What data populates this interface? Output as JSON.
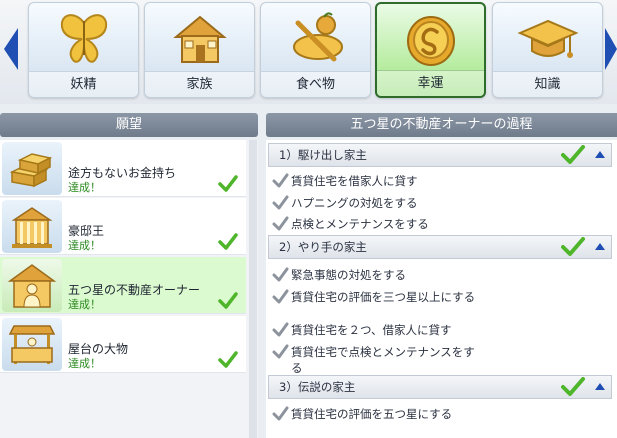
{
  "categories": {
    "tabs": [
      {
        "label": "妖精",
        "icon": "butterfly-icon"
      },
      {
        "label": "家族",
        "icon": "house-icon"
      },
      {
        "label": "食べ物",
        "icon": "food-icon"
      },
      {
        "label": "幸運",
        "icon": "lucky-coin-icon",
        "active": true
      },
      {
        "label": "知識",
        "icon": "graduation-cap-icon"
      }
    ]
  },
  "left_panel": {
    "title": "願望",
    "aspirations": [
      {
        "name": "途方もないお金持ち",
        "status": "達成！",
        "icon": "gold-bars-icon"
      },
      {
        "name": "豪邸王",
        "status": "達成！",
        "icon": "mansion-icon"
      },
      {
        "name": "五つ星の不動産オーナー",
        "status": "達成！",
        "icon": "property-owner-icon",
        "selected": true
      },
      {
        "name": "屋台の大物",
        "status": "達成！",
        "icon": "market-stall-icon"
      }
    ]
  },
  "right_panel": {
    "title": "五つ星の不動産オーナーの過程",
    "milestones": [
      {
        "title": "1）駆け出し家主",
        "objectives": [
          "賃貸住宅を借家人に貸す",
          "ハプニングの対処をする",
          "点検とメンテナンスをする"
        ]
      },
      {
        "title": "2）やり手の家主",
        "objectives": [
          "緊急事態の対処をする",
          "賃貸住宅の評価を三つ星以上にする",
          "賃貸住宅を２つ、借家人に貸す",
          "賃貸住宅で点検とメンテナンスをする"
        ]
      },
      {
        "title": "3）伝説の家主",
        "objectives": [
          "賃貸住宅の評価を五つ星にする"
        ]
      }
    ]
  },
  "colors": {
    "check_green": "#4fb52a",
    "grey_check": "#8c939c",
    "active_tab_border": "#2f6b2a",
    "selected_row": "#dcfad0",
    "nav_arrow": "#1f4fb3"
  }
}
